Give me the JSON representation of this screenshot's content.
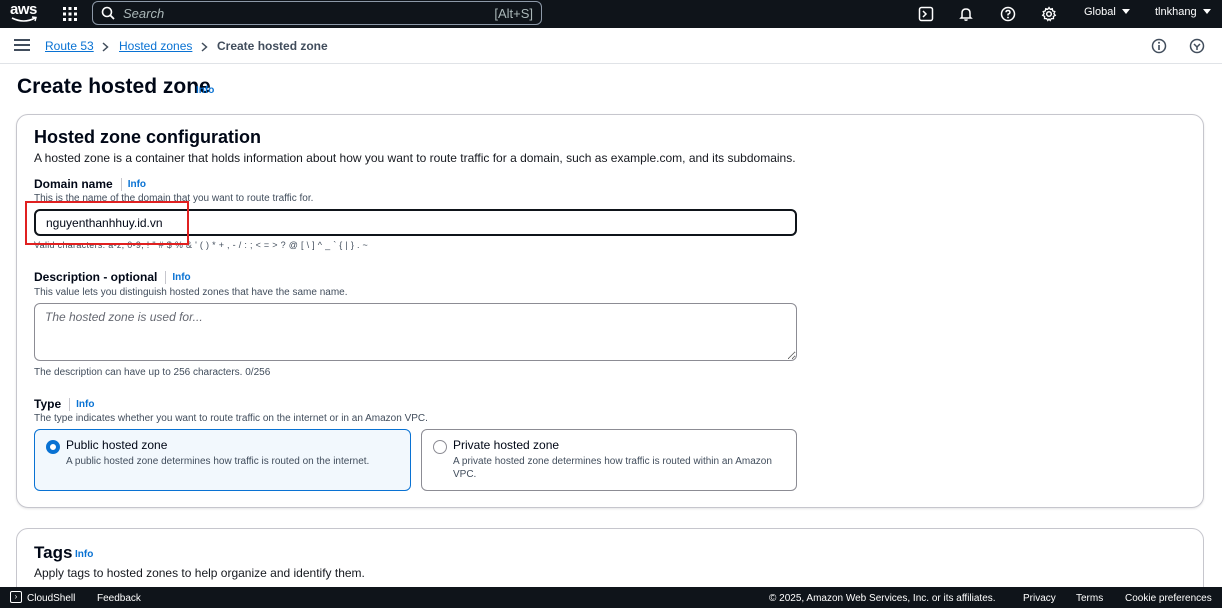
{
  "topnav": {
    "logo_text": "aws",
    "search_placeholder": "Search",
    "search_shortcut": "[Alt+S]",
    "region_label": "Global",
    "user_label": "tlnkhang"
  },
  "breadcrumb": {
    "items": [
      "Route 53",
      "Hosted zones"
    ],
    "current": "Create hosted zone"
  },
  "page": {
    "title": "Create hosted zone",
    "info_label": "Info"
  },
  "config": {
    "heading": "Hosted zone configuration",
    "description": "A hosted zone is a container that holds information about how you want to route traffic for a domain, such as example.com, and its subdomains.",
    "domain": {
      "label": "Domain name",
      "info": "Info",
      "hint": "This is the name of the domain that you want to route traffic for.",
      "value": "nguyenthanhhuy.id.vn",
      "valid_chars": "Valid characters: a-z, 0-9, ! \" # $ % & ' ( ) * + , - / : ; < = > ? @ [ \\ ] ^ _ ` { | } . ~"
    },
    "description_field": {
      "label": "Description - optional",
      "info": "Info",
      "hint": "This value lets you distinguish hosted zones that have the same name.",
      "placeholder": "The hosted zone is used for...",
      "counter": "The description can have up to 256 characters. 0/256"
    },
    "type": {
      "label": "Type",
      "info": "Info",
      "hint": "The type indicates whether you want to route traffic on the internet or in an Amazon VPC.",
      "options": [
        {
          "title": "Public hosted zone",
          "desc": "A public hosted zone determines how traffic is routed on the internet.",
          "selected": true
        },
        {
          "title": "Private hosted zone",
          "desc": "A private hosted zone determines how traffic is routed within an Amazon VPC.",
          "selected": false
        }
      ]
    }
  },
  "tags": {
    "heading": "Tags",
    "info": "Info",
    "description": "Apply tags to hosted zones to help organize and identify them."
  },
  "footer": {
    "cloudshell": "CloudShell",
    "feedback": "Feedback",
    "copyright": "© 2025, Amazon Web Services, Inc. or its affiliates.",
    "privacy": "Privacy",
    "terms": "Terms",
    "cookies": "Cookie preferences"
  },
  "colors": {
    "nav_bg": "#0f141a",
    "link": "#0972d3",
    "highlight": "#e02020"
  },
  "icons": [
    "grid-icon",
    "search-icon",
    "cloudshell-icon",
    "bell-icon",
    "help-icon",
    "gear-icon",
    "caret-down-icon",
    "hamburger-icon",
    "info-circle-icon",
    "feedback-circle-icon"
  ]
}
